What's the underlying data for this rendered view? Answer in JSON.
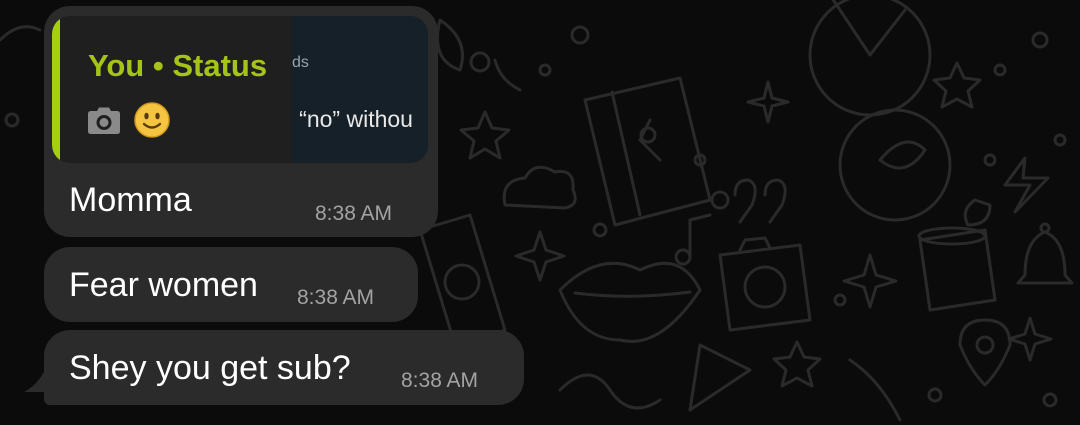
{
  "chat": {
    "messages": [
      {
        "reply": {
          "author": "You • Status",
          "media_icon": "camera-icon",
          "emoji": "🙂",
          "thumbnail_caption": "ds",
          "thumbnail_text": "g “no” withou"
        },
        "text": "Momma",
        "time": "8:38 AM"
      },
      {
        "text": "Fear women",
        "time": "8:38 AM"
      },
      {
        "text": "Shey you get sub?",
        "time": "8:38 AM"
      }
    ]
  },
  "colors": {
    "background": "#0b0b0b",
    "bubble": "#2b2b2b",
    "reply_card": "#1f1f1f",
    "reply_accent": "#a5d010",
    "reply_author": "#a5c41a",
    "timestamp": "#a3a3a3"
  }
}
